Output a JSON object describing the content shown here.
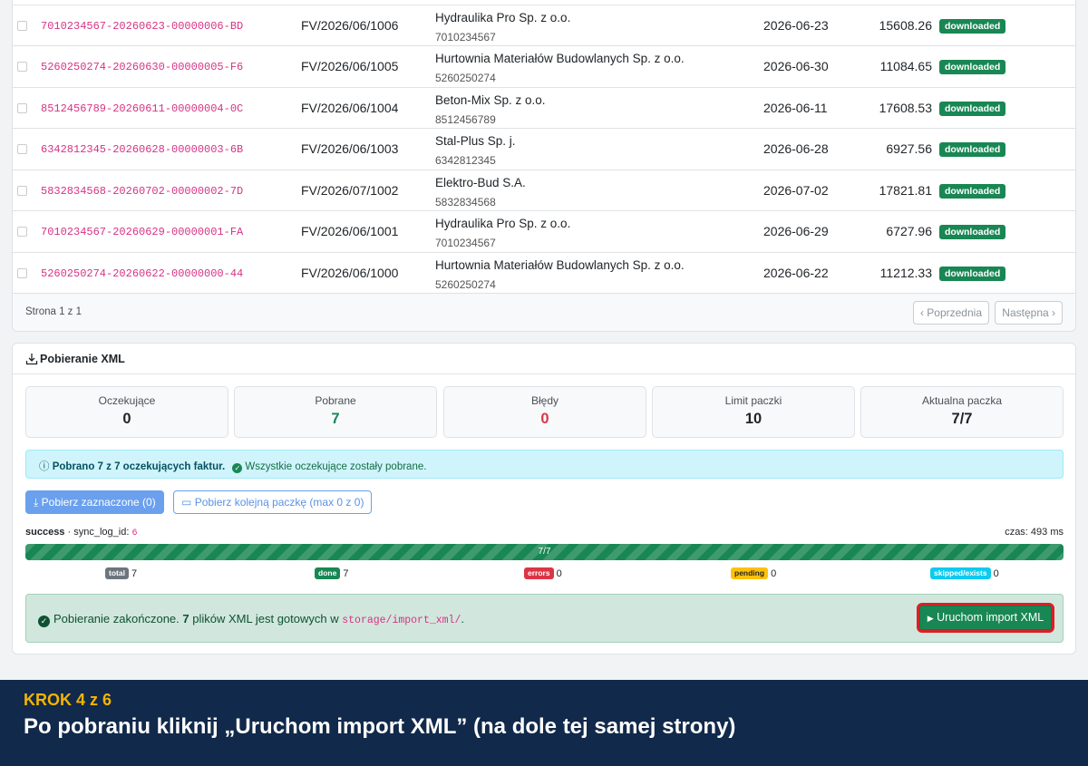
{
  "invoices": [
    {
      "ksef": "7010234567-20260623-00000006-BD",
      "number": "FV/2026/06/1006",
      "seller": "Hydraulika Pro Sp. z o.o.",
      "nip": "7010234567",
      "date": "2026-06-23",
      "amount": "15608.26",
      "status": "downloaded"
    },
    {
      "ksef": "5260250274-20260630-00000005-F6",
      "number": "FV/2026/06/1005",
      "seller": "Hurtownia Materiałów Budowlanych Sp. z o.o.",
      "nip": "5260250274",
      "date": "2026-06-30",
      "amount": "11084.65",
      "status": "downloaded"
    },
    {
      "ksef": "8512456789-20260611-00000004-0C",
      "number": "FV/2026/06/1004",
      "seller": "Beton-Mix Sp. z o.o.",
      "nip": "8512456789",
      "date": "2026-06-11",
      "amount": "17608.53",
      "status": "downloaded"
    },
    {
      "ksef": "6342812345-20260628-00000003-6B",
      "number": "FV/2026/06/1003",
      "seller": "Stal-Plus Sp. j.",
      "nip": "6342812345",
      "date": "2026-06-28",
      "amount": "6927.56",
      "status": "downloaded"
    },
    {
      "ksef": "5832834568-20260702-00000002-7D",
      "number": "FV/2026/07/1002",
      "seller": "Elektro-Bud S.A.",
      "nip": "5832834568",
      "date": "2026-07-02",
      "amount": "17821.81",
      "status": "downloaded"
    },
    {
      "ksef": "7010234567-20260629-00000001-FA",
      "number": "FV/2026/06/1001",
      "seller": "Hydraulika Pro Sp. z o.o.",
      "nip": "7010234567",
      "date": "2026-06-29",
      "amount": "6727.96",
      "status": "downloaded"
    },
    {
      "ksef": "5260250274-20260622-00000000-44",
      "number": "FV/2026/06/1000",
      "seller": "Hurtownia Materiałów Budowlanych Sp. z o.o.",
      "nip": "5260250274",
      "date": "2026-06-22",
      "amount": "11212.33",
      "status": "downloaded"
    }
  ],
  "pagination": {
    "info": "Strona 1 z 1",
    "prev": "‹ Poprzednia",
    "next": "Następna ›"
  },
  "xml": {
    "title": "Pobieranie XML",
    "stats": [
      {
        "label": "Oczekujące",
        "value": "0",
        "color": "#212529"
      },
      {
        "label": "Pobrane",
        "value": "7",
        "color": "#198754"
      },
      {
        "label": "Błędy",
        "value": "0",
        "color": "#dc3545"
      },
      {
        "label": "Limit paczki",
        "value": "10",
        "color": "#212529"
      },
      {
        "label": "Aktualna paczka",
        "value": "7/7",
        "color": "#212529"
      }
    ],
    "info_bold": "Pobrano 7 z 7 oczekujących faktur.",
    "info_ok": "Wszystkie oczekujące zostały pobrane.",
    "btn_selected": "Pobierz zaznaczone (0)",
    "btn_next_batch": "Pobierz kolejną paczkę (max 0 z 0)",
    "sync_status": "success",
    "sync_label": "· sync_log_id:",
    "sync_id": "6",
    "time": "czas: 493 ms",
    "progress_label": "7/7",
    "progress_fraction": 1.0,
    "counters": [
      {
        "label": "total",
        "value": "7",
        "color": "#6c757d",
        "text_color": "#fff"
      },
      {
        "label": "done",
        "value": "7",
        "color": "#198754",
        "text_color": "#fff"
      },
      {
        "label": "errors",
        "value": "0",
        "color": "#dc3545",
        "text_color": "#fff"
      },
      {
        "label": "pending",
        "value": "0",
        "color": "#ffc107",
        "text_color": "#212529"
      },
      {
        "label": "skipped/exists",
        "value": "0",
        "color": "#0dcaf0",
        "text_color": "#fff"
      }
    ],
    "done_text_1": "Pobieranie zakończone.",
    "done_count": "7",
    "done_text_2": "plików XML jest gotowych w",
    "done_path": "storage/import_xml/",
    "done_dot": ".",
    "run_button": "Uruchom import XML"
  },
  "banner": {
    "step": "KROK 4 z 6",
    "message": "Po pobraniu kliknij „Uruchom import XML” (na dole tej samej strony)"
  }
}
